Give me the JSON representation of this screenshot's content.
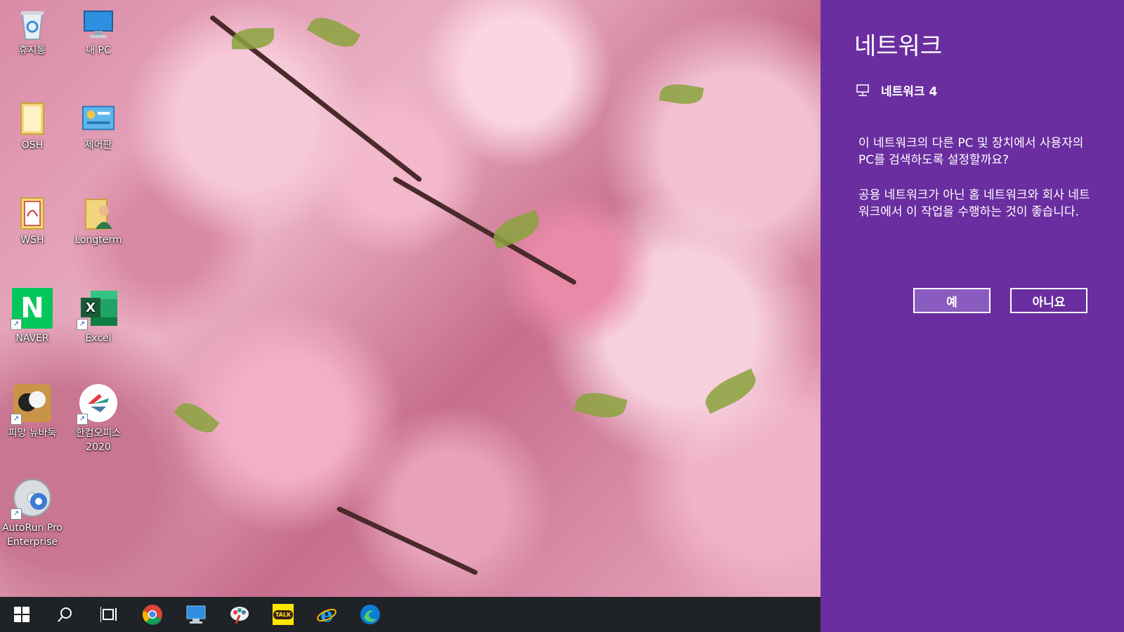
{
  "desktop": {
    "icons": [
      {
        "label": "휴지통",
        "icon": "recycle-bin-icon"
      },
      {
        "label": "내 PC",
        "icon": "this-pc-icon"
      },
      {
        "label": "OSH",
        "icon": "folder-icon"
      },
      {
        "label": "제어판",
        "icon": "control-panel-icon"
      },
      {
        "label": "WSH",
        "icon": "folder-icon"
      },
      {
        "label": "Longterm",
        "icon": "user-folder-icon"
      },
      {
        "label": "NAVER",
        "icon": "naver-icon"
      },
      {
        "label": "Excel",
        "icon": "excel-icon"
      },
      {
        "label": "피망 뉴바둑",
        "icon": "baduk-icon"
      },
      {
        "label": "한컴오피스 2020",
        "icon": "hancom-office-icon"
      },
      {
        "label": "AutoRun Pro Enterprise",
        "icon": "autorun-icon"
      }
    ]
  },
  "taskbar": {
    "items": [
      {
        "icon": "start-icon"
      },
      {
        "icon": "search-icon"
      },
      {
        "icon": "task-view-icon"
      },
      {
        "icon": "chrome-icon"
      },
      {
        "icon": "this-pc-taskbar-icon"
      },
      {
        "icon": "paint-icon"
      },
      {
        "icon": "kakaotalk-icon",
        "label": "TALK"
      },
      {
        "icon": "internet-explorer-icon"
      },
      {
        "icon": "edge-icon"
      }
    ]
  },
  "network_panel": {
    "title": "네트워크",
    "network_name": "네트워크 4",
    "network_icon": "network-icon",
    "question": "이 네트워크의 다른 PC 및 장치에서 사용자의 PC를 검색하도록 설정할까요?",
    "advice": "공용 네트워크가 아닌 홈 네트워크와 회사 네트워크에서 이 작업을 수행하는 것이 좋습니다.",
    "yes_label": "예",
    "no_label": "아니요",
    "colors": {
      "background": "#6a2ea0",
      "yes_button": "#8a5cc0",
      "text": "#ffffff"
    }
  }
}
